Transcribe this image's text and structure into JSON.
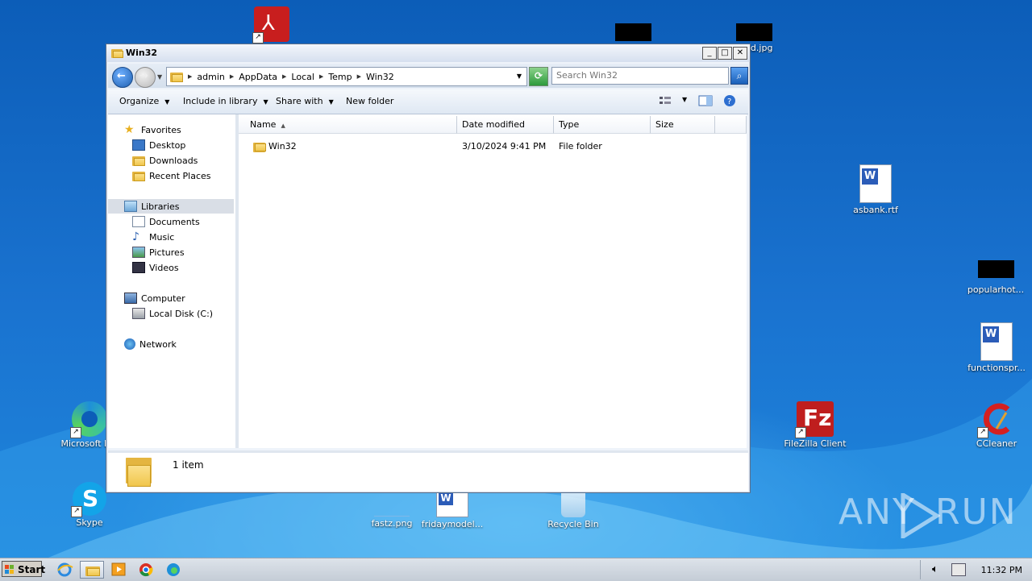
{
  "window": {
    "title": "Win32",
    "controls": {
      "minimize": "_",
      "maximize": "□",
      "close": "✕"
    }
  },
  "address": {
    "crumbs": [
      "admin",
      "AppData",
      "Local",
      "Temp",
      "Win32"
    ]
  },
  "search": {
    "placeholder": "Search Win32"
  },
  "toolbar": {
    "organize": "Organize",
    "include": "Include in library",
    "share": "Share with",
    "new_folder": "New folder"
  },
  "nav": {
    "favorites": "Favorites",
    "desktop": "Desktop",
    "downloads": "Downloads",
    "recent": "Recent Places",
    "libraries": "Libraries",
    "documents": "Documents",
    "music": "Music",
    "pictures": "Pictures",
    "videos": "Videos",
    "computer": "Computer",
    "local_disk": "Local Disk (C:)",
    "network": "Network"
  },
  "columns": {
    "name": "Name",
    "date": "Date modified",
    "type": "Type",
    "size": "Size"
  },
  "files": [
    {
      "name": "Win32",
      "date": "3/10/2024 9:41 PM",
      "type": "File folder",
      "size": ""
    }
  ],
  "status": {
    "count": "1 item"
  },
  "desktop_icons": {
    "valid": "valid.jpg",
    "asbank": "asbank.rtf",
    "popularhot": "popularhot...",
    "functionspr": "functionspr...",
    "ccleaner": "CCleaner",
    "filezilla": "FileZilla Client",
    "edge": "Microsoft E...",
    "skype": "Skype",
    "fastz": "fastz.png",
    "fridaymodel": "fridaymodel...",
    "recycle": "Recycle Bin"
  },
  "taskbar": {
    "start": "Start",
    "clock": "11:32 PM"
  },
  "watermark": {
    "left": "ANY",
    "right": "RUN"
  },
  "colors": {
    "accent": "#1a5fb8",
    "desktop": "#1565c8",
    "folder": "#f0c64d"
  }
}
